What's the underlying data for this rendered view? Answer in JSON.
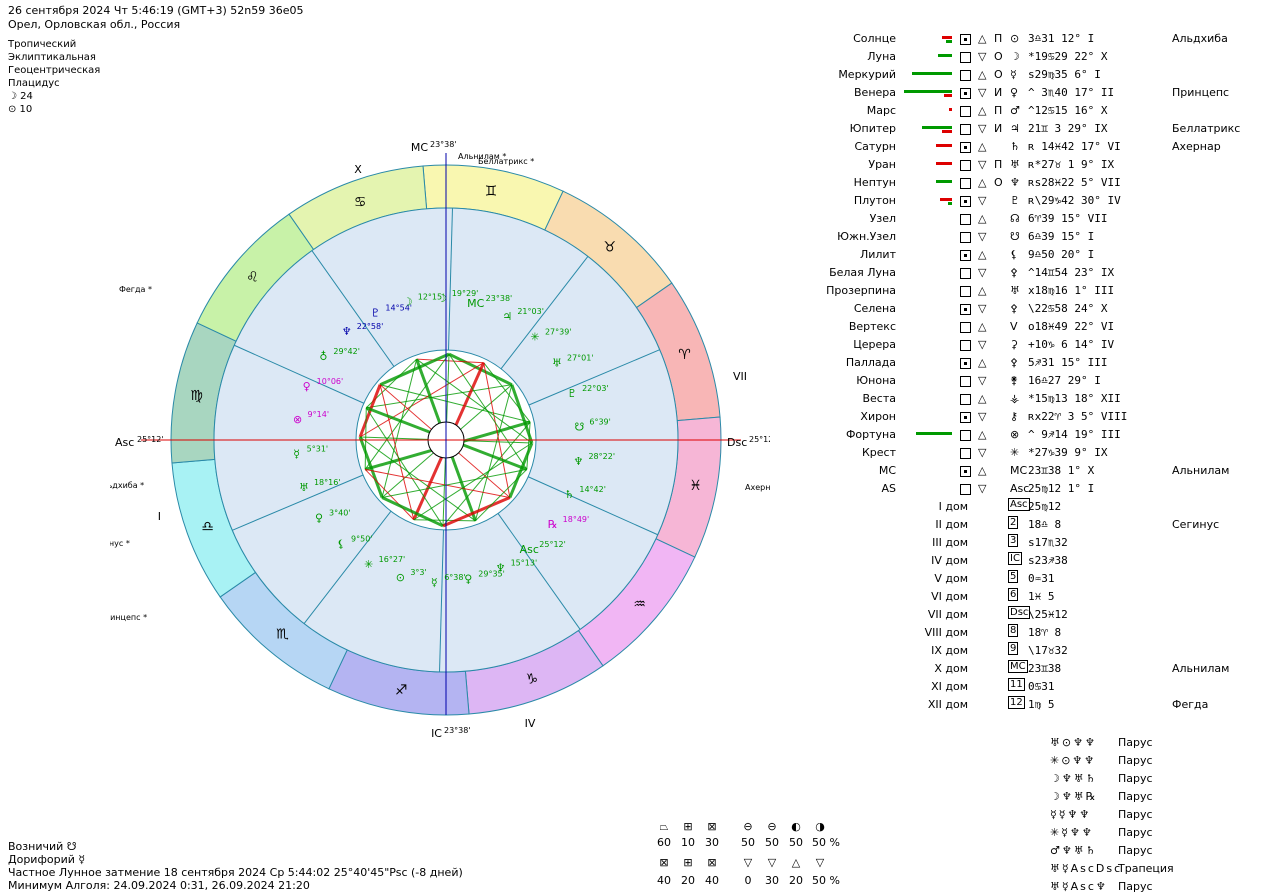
{
  "header": {
    "line1": "26 сентября 2024  Чт   5:46:19 (GMT+3) 52n59  36e05",
    "line2": "Орел, Орловская обл., Россия",
    "settings": [
      "Тропический",
      "Эклиптикальная",
      "Геоцентрическая",
      "Плацидус"
    ],
    "moon_label": "☽  24",
    "sun_label": "⊙  10"
  },
  "chart": {
    "mc_label": "MC",
    "mc_deg": "23°38'",
    "ic_label": "IC",
    "ic_deg": "23°38'",
    "asc_label": "Asc",
    "asc_deg": "25°12'",
    "dsc_label": "Dsc",
    "dsc_deg": "25°12'",
    "quadrants": [
      "X",
      "VII",
      "IV",
      "I"
    ],
    "stars": [
      "Альнилам",
      "Беллатрикс",
      "Ахернар",
      "Фегда",
      "Альдхиба",
      "Сегинус",
      "Принцепс"
    ],
    "zodiac_glyphs": [
      "♊",
      "♉",
      "♈",
      "♓",
      "♒",
      "♑",
      "♐",
      "♏",
      "♎",
      "♍",
      "♌",
      "♋"
    ],
    "planet_labels": [
      {
        "glyph": "♆",
        "deg": "22°58'",
        "color": "#0000aa"
      },
      {
        "glyph": "♇",
        "deg": "14°54'",
        "color": "#0000aa"
      },
      {
        "glyph": "☽",
        "deg": "12°15'",
        "color": "#009900"
      },
      {
        "glyph": "☽",
        "deg": "19°29'",
        "color": "#009900"
      },
      {
        "glyph": "MC",
        "deg": "23°38'",
        "color": "#009900"
      },
      {
        "glyph": "♃",
        "deg": "21°03'",
        "color": "#009900"
      },
      {
        "glyph": "✳",
        "deg": "27°39'",
        "color": "#009900"
      },
      {
        "glyph": "♅",
        "deg": "27°01'",
        "color": "#009900"
      },
      {
        "glyph": "♇",
        "deg": "22°03'",
        "color": "#009900"
      },
      {
        "glyph": "☋",
        "deg": "6°39'",
        "color": "#009900"
      },
      {
        "glyph": "♆",
        "deg": "28°22'",
        "color": "#009900"
      },
      {
        "glyph": "♄",
        "deg": "14°42'",
        "color": "#009900"
      },
      {
        "glyph": "℞",
        "deg": "18°49'",
        "color": "#cc00cc"
      },
      {
        "glyph": "Asc",
        "deg": "25°12'",
        "color": "#009900"
      },
      {
        "glyph": "♆",
        "deg": "15°13'",
        "color": "#009900"
      },
      {
        "glyph": "♀",
        "deg": "29°35'",
        "color": "#009900"
      },
      {
        "glyph": "☿",
        "deg": "6°38'",
        "color": "#009900"
      },
      {
        "glyph": "⊙",
        "deg": "3°3'",
        "color": "#009900"
      },
      {
        "glyph": "✳",
        "deg": "16°27'",
        "color": "#009900"
      },
      {
        "glyph": "⚸",
        "deg": "9°50'",
        "color": "#009900"
      },
      {
        "glyph": "♀",
        "deg": "3°40'",
        "color": "#009900"
      },
      {
        "glyph": "♅",
        "deg": "18°16'",
        "color": "#009900"
      },
      {
        "glyph": "☿",
        "deg": "5°31'",
        "color": "#009900"
      },
      {
        "glyph": "⊗",
        "deg": "9°14'",
        "color": "#cc00cc"
      },
      {
        "glyph": "♀",
        "deg": "10°06'",
        "color": "#cc00cc"
      },
      {
        "glyph": "♁",
        "deg": "29°42'",
        "color": "#009900"
      }
    ]
  },
  "planets": [
    {
      "name": "Солнце",
      "g3": "П",
      "g4": "⊙",
      "pos": "  3♎31 12°  I",
      "star": "Альдхиба",
      "bars": [
        {
          "w": 10,
          "c": "#dd0000"
        },
        {
          "w": 6,
          "c": "#009900"
        }
      ]
    },
    {
      "name": "Луна",
      "g3": "О",
      "g4": "☽",
      "pos": "*19♋29 22°  X",
      "star": "",
      "bars": [
        {
          "w": 14,
          "c": "#009900"
        }
      ]
    },
    {
      "name": "Меркурий",
      "g3": "О",
      "g4": "☿",
      "pos": "s29♍35  6°  I",
      "star": "",
      "bars": [
        {
          "w": 40,
          "c": "#009900"
        }
      ]
    },
    {
      "name": "Венера",
      "g3": "И",
      "g4": "♀",
      "pos": "^ 3♏40 17° II",
      "star": "Принцепс",
      "bars": [
        {
          "w": 48,
          "c": "#009900"
        },
        {
          "w": 8,
          "c": "#dd0000"
        }
      ]
    },
    {
      "name": "Марс",
      "g3": "П",
      "g4": "♂",
      "pos": "^12♋15 16°  X",
      "star": "",
      "bars": [
        {
          "w": 3,
          "c": "#dd0000"
        }
      ]
    },
    {
      "name": "Юпитер",
      "g3": "И",
      "g4": "♃",
      "pos": " 21♊ 3 29° IX",
      "star": "Беллатрикс",
      "bars": [
        {
          "w": 30,
          "c": "#009900"
        },
        {
          "w": 10,
          "c": "#dd0000"
        }
      ]
    },
    {
      "name": "Сатурн",
      "g3": "",
      "g4": "♄",
      "pos": "ʀ 14♓42 17° VI",
      "star": "Ахернар",
      "bars": [
        {
          "w": 16,
          "c": "#dd0000"
        }
      ]
    },
    {
      "name": "Уран",
      "g3": "П",
      "g4": "♅",
      "pos": "ʀ*27♉ 1  9° IX",
      "star": "",
      "bars": [
        {
          "w": 16,
          "c": "#dd0000"
        }
      ]
    },
    {
      "name": "Нептун",
      "g3": "О",
      "g4": "♆",
      "pos": "ʀs28♓22  5° VII",
      "star": "",
      "bars": [
        {
          "w": 16,
          "c": "#009900"
        }
      ]
    },
    {
      "name": "Плутон",
      "g3": "",
      "g4": "♇",
      "pos": "ʀ\\29♑42 30° IV",
      "star": "",
      "bars": [
        {
          "w": 12,
          "c": "#dd0000"
        },
        {
          "w": 4,
          "c": "#009900"
        }
      ]
    },
    {
      "name": "Узел",
      "g3": "",
      "g4": "☊",
      "pos": "  6♈39 15° VII",
      "star": "",
      "bars": []
    },
    {
      "name": "Южн.Узел",
      "g3": "",
      "g4": "☋",
      "pos": "  6♎39 15°  I",
      "star": "",
      "bars": []
    },
    {
      "name": "Лилит",
      "g3": "",
      "g4": "⚸",
      "pos": "  9♎50 20°  I",
      "star": "",
      "bars": []
    },
    {
      "name": "Белая Луна",
      "g3": "",
      "g4": "⚴",
      "pos": "^14♊54 23° IX",
      "star": "",
      "bars": []
    },
    {
      "name": "Прозерпина",
      "g3": "",
      "g4": "♅",
      "pos": "x18♍16  1° III",
      "star": "",
      "bars": []
    },
    {
      "name": "Селена",
      "g3": "",
      "g4": "⚴",
      "pos": "\\22♋58 24°  X",
      "star": "",
      "bars": []
    },
    {
      "name": "Вертекс",
      "g3": "",
      "g4": "V",
      "pos": "o18♓49 22° VI",
      "star": "",
      "bars": []
    },
    {
      "name": "Церера",
      "g3": "",
      "g4": "⚳",
      "pos": "+10♑ 6 14° IV",
      "star": "",
      "bars": []
    },
    {
      "name": "Паллада",
      "g3": "",
      "g4": "⚴",
      "pos": "  5♐31 15° III",
      "star": "",
      "bars": []
    },
    {
      "name": "Юнона",
      "g3": "",
      "g4": "⚵",
      "pos": " 16♎27 29°  I",
      "star": "",
      "bars": []
    },
    {
      "name": "Веста",
      "g3": "",
      "g4": "⚶",
      "pos": "*15♍13 18° XII",
      "star": "",
      "bars": []
    },
    {
      "name": "Хирон",
      "g3": "",
      "g4": "⚷",
      "pos": "ʀx22♈ 3  5° VIII",
      "star": "",
      "bars": []
    },
    {
      "name": "Фортуна",
      "g3": "",
      "g4": "⊗",
      "pos": "^ 9♐14 19° III",
      "star": "",
      "bars": [
        {
          "w": 36,
          "c": "#009900"
        }
      ]
    },
    {
      "name": "Крест",
      "g3": "",
      "g4": "✳",
      "pos": "*27♑39  9° IX",
      "star": "",
      "bars": []
    },
    {
      "name": "МС",
      "g3": "",
      "g4": "MC",
      "pos": " 23♊38  1°  X",
      "star": "Альнилам",
      "bars": []
    },
    {
      "name": "AS",
      "g3": "",
      "g4": "Asc",
      "pos": " 25♍12  1°  I",
      "star": "",
      "bars": []
    }
  ],
  "houses": [
    {
      "name": "I дом",
      "icon": "Asc",
      "pos": " 25♍12",
      "star": ""
    },
    {
      "name": "II дом",
      "icon": "2",
      "pos": " 18♎ 8",
      "star": "Сегинус"
    },
    {
      "name": "III дом",
      "icon": "3",
      "pos": "s17♏32",
      "star": ""
    },
    {
      "name": "IV дом",
      "icon": "IC",
      "pos": "s23♐38",
      "star": ""
    },
    {
      "name": "V дом",
      "icon": "5",
      "pos": "  0♒31",
      "star": ""
    },
    {
      "name": "VI дом",
      "icon": "6",
      "pos": "  1♓ 5",
      "star": ""
    },
    {
      "name": "VII дом",
      "icon": "Dsc",
      "pos": "\\25♓12",
      "star": ""
    },
    {
      "name": "VIII дом",
      "icon": "8",
      "pos": " 18♈ 8",
      "star": ""
    },
    {
      "name": "IX дом",
      "icon": "9",
      "pos": "\\17♉32",
      "star": ""
    },
    {
      "name": "X дом",
      "icon": "MC",
      "pos": " 23♊38",
      "star": "Альнилам"
    },
    {
      "name": "XI дом",
      "icon": "11",
      "pos": "  0♋31",
      "star": ""
    },
    {
      "name": "XII дом",
      "icon": "12",
      "pos": "  1♍ 5",
      "star": "Фегда"
    }
  ],
  "figures": [
    {
      "glyphs": "♅⊙♆♆",
      "label": "Парус"
    },
    {
      "glyphs": "✳⊙♆♆",
      "label": "Парус"
    },
    {
      "glyphs": "☽♆♅♄",
      "label": "Парус"
    },
    {
      "glyphs": "☽♆♅℞",
      "label": "Парус"
    },
    {
      "glyphs": "☿☿♆♆",
      "label": "Парус"
    },
    {
      "glyphs": "✳☿♆♆",
      "label": "Парус"
    },
    {
      "glyphs": "♂♆♅♄",
      "label": "Парус"
    },
    {
      "glyphs": "♅☿AscDsc",
      "label": "Трапеция"
    },
    {
      "glyphs": "♅☿Asc♆",
      "label": "Парус"
    }
  ],
  "footer": {
    "vozn": "Возничий  ☋",
    "dor": "Дорифорий  ☿",
    "eclipse": "Частное Лунное затмение 18 сентября 2024 Ср  5:44:02 25°40'45\"Psc (-8 дней)",
    "algol": "Минимум Алголя: 24.09.2024  0:31,  26.09.2024 21:20"
  },
  "stats": {
    "row1_values": [
      "60",
      "10",
      "30"
    ],
    "row1_values_b": [
      "50",
      "50",
      "50",
      "50 %"
    ],
    "row2_values": [
      "40",
      "20",
      "40"
    ],
    "row2_values_b": [
      "0",
      "30",
      "20",
      "50 %"
    ]
  },
  "colors": {
    "inner_bg": "#dce8f5",
    "green": "#009900",
    "red": "#dd0000",
    "magenta": "#cc00cc",
    "blue": "#0000aa"
  }
}
